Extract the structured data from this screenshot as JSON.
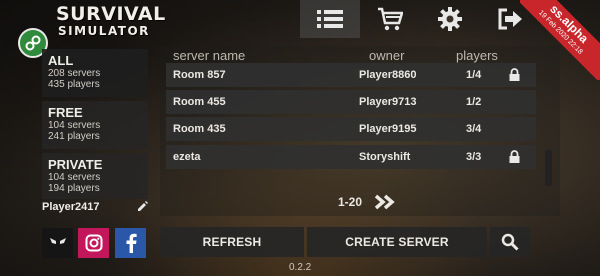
{
  "app": {
    "title": "SURVIVAL",
    "subtitle": "SIMULATOR",
    "version_ribbon": "ss.alpha",
    "ribbon_date": "19 Feb 2020 22:18",
    "footer_version": "0.2.2"
  },
  "nav": {
    "items": [
      {
        "icon": "list-icon",
        "active": true
      },
      {
        "icon": "cart-icon",
        "active": false
      },
      {
        "icon": "gear-icon",
        "active": false
      },
      {
        "icon": "exit-icon",
        "active": false
      }
    ]
  },
  "filters": [
    {
      "title": "ALL",
      "servers": "208 servers",
      "players": "435 players"
    },
    {
      "title": "FREE",
      "servers": "104 servers",
      "players": "241 players"
    },
    {
      "title": "PRIVATE",
      "servers": "104 servers",
      "players": "194 players"
    }
  ],
  "user": {
    "name": "Player2417",
    "edit_icon": "pencil-icon"
  },
  "social": [
    {
      "icon": "alien-icon",
      "color": "#151515"
    },
    {
      "icon": "instagram-icon",
      "color": "#c2185b"
    },
    {
      "icon": "facebook-icon",
      "color": "#2a57a8"
    }
  ],
  "table": {
    "headers": {
      "name": "server name",
      "owner": "owner",
      "players": "players"
    },
    "rows": [
      {
        "name": "Room 857",
        "owner": "Player8860",
        "players": "1/4",
        "locked": true
      },
      {
        "name": "Room 455",
        "owner": "Player9713",
        "players": "1/2",
        "locked": false
      },
      {
        "name": "Room 435",
        "owner": "Player9195",
        "players": "3/4",
        "locked": false
      },
      {
        "name": "ezeta",
        "owner": "Storyshift",
        "players": "3/3",
        "locked": true
      }
    ]
  },
  "pager": {
    "range": "1-20",
    "next_icon": "double-chevron-right-icon"
  },
  "buttons": {
    "refresh": "REFRESH",
    "create": "CREATE SERVER",
    "search_icon": "search-icon"
  },
  "colors": {
    "accent_red": "#c8262b",
    "badge_green": "#2f8a3c"
  }
}
